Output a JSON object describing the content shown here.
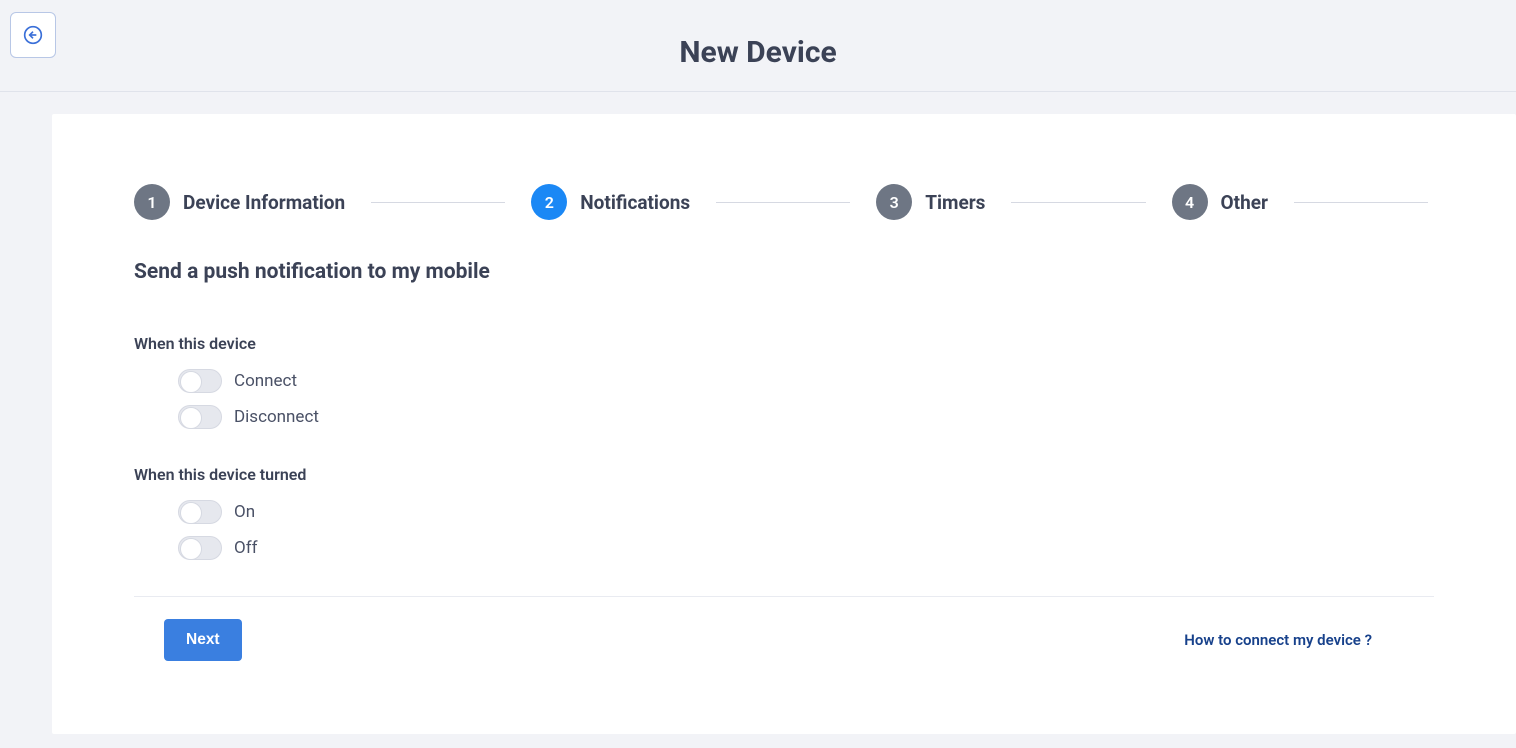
{
  "header": {
    "title": "New Device"
  },
  "steps": [
    {
      "num": "1",
      "label": "Device Information",
      "active": false
    },
    {
      "num": "2",
      "label": "Notifications",
      "active": true
    },
    {
      "num": "3",
      "label": "Timers",
      "active": false
    },
    {
      "num": "4",
      "label": "Other",
      "active": false
    }
  ],
  "section": {
    "title": "Send a push notification to my mobile",
    "groups": [
      {
        "label": "When this device",
        "options": [
          {
            "label": "Connect"
          },
          {
            "label": "Disconnect"
          }
        ]
      },
      {
        "label": "When this device turned",
        "options": [
          {
            "label": "On"
          },
          {
            "label": "Off"
          }
        ]
      }
    ]
  },
  "footer": {
    "next": "Next",
    "help": "How to connect my device ?"
  }
}
